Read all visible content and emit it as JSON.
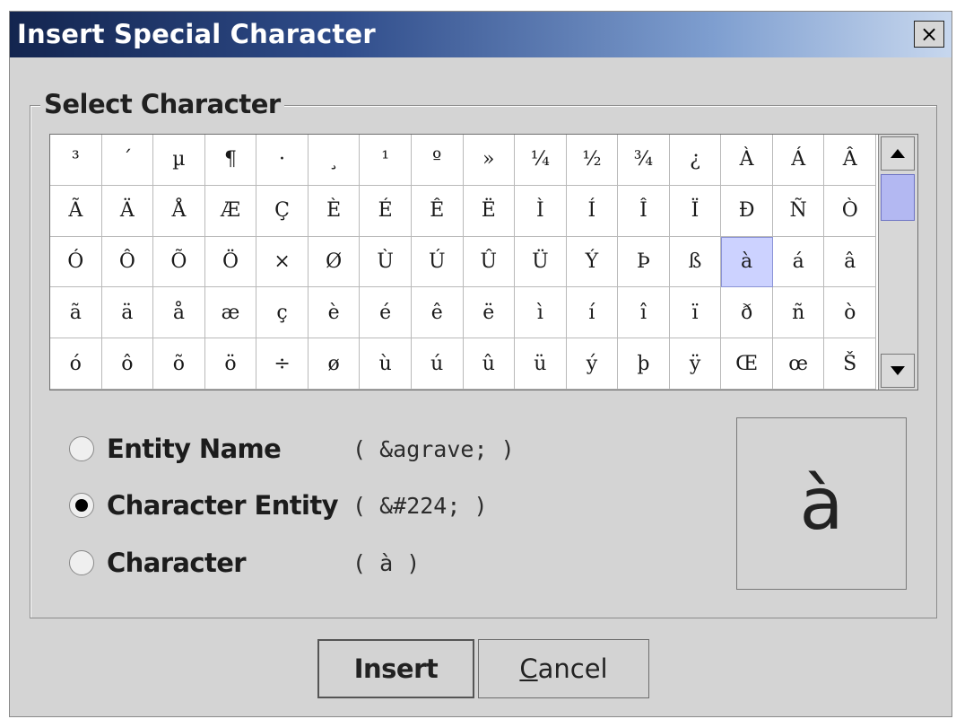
{
  "window": {
    "title": "Insert Special Character",
    "close_label": "×"
  },
  "group": {
    "legend": "Select Character"
  },
  "chars": [
    [
      "³",
      "´",
      "µ",
      "¶",
      "·",
      "¸",
      "¹",
      "º",
      "»",
      "¼",
      "½",
      "¾",
      "¿",
      "À",
      "Á",
      "Â"
    ],
    [
      "Ã",
      "Ä",
      "Å",
      "Æ",
      "Ç",
      "È",
      "É",
      "Ê",
      "Ë",
      "Ì",
      "Í",
      "Î",
      "Ï",
      "Ð",
      "Ñ",
      "Ò"
    ],
    [
      "Ó",
      "Ô",
      "Õ",
      "Ö",
      "×",
      "Ø",
      "Ù",
      "Ú",
      "Û",
      "Ü",
      "Ý",
      "Þ",
      "ß",
      "à",
      "á",
      "â"
    ],
    [
      "ã",
      "ä",
      "å",
      "æ",
      "ç",
      "è",
      "é",
      "ê",
      "ë",
      "ì",
      "í",
      "î",
      "ï",
      "ð",
      "ñ",
      "ò"
    ],
    [
      "ó",
      "ô",
      "õ",
      "ö",
      "÷",
      "ø",
      "ù",
      "ú",
      "û",
      "ü",
      "ý",
      "þ",
      "ÿ",
      "Œ",
      "œ",
      "Š"
    ]
  ],
  "selected": {
    "row": 2,
    "col": 13
  },
  "options": [
    {
      "label": "Entity Name",
      "value": "( &agrave; )"
    },
    {
      "label": "Character Entity",
      "value": "( &#224; )"
    },
    {
      "label": "Character",
      "value": "( à )"
    }
  ],
  "selected_option": 1,
  "preview": "à",
  "buttons": {
    "insert": "Insert",
    "cancel_mnemonic": "C",
    "cancel_rest": "ancel"
  },
  "icons": {
    "close": "close-icon",
    "scroll_up": "triangle-up-icon",
    "scroll_down": "triangle-down-icon"
  }
}
